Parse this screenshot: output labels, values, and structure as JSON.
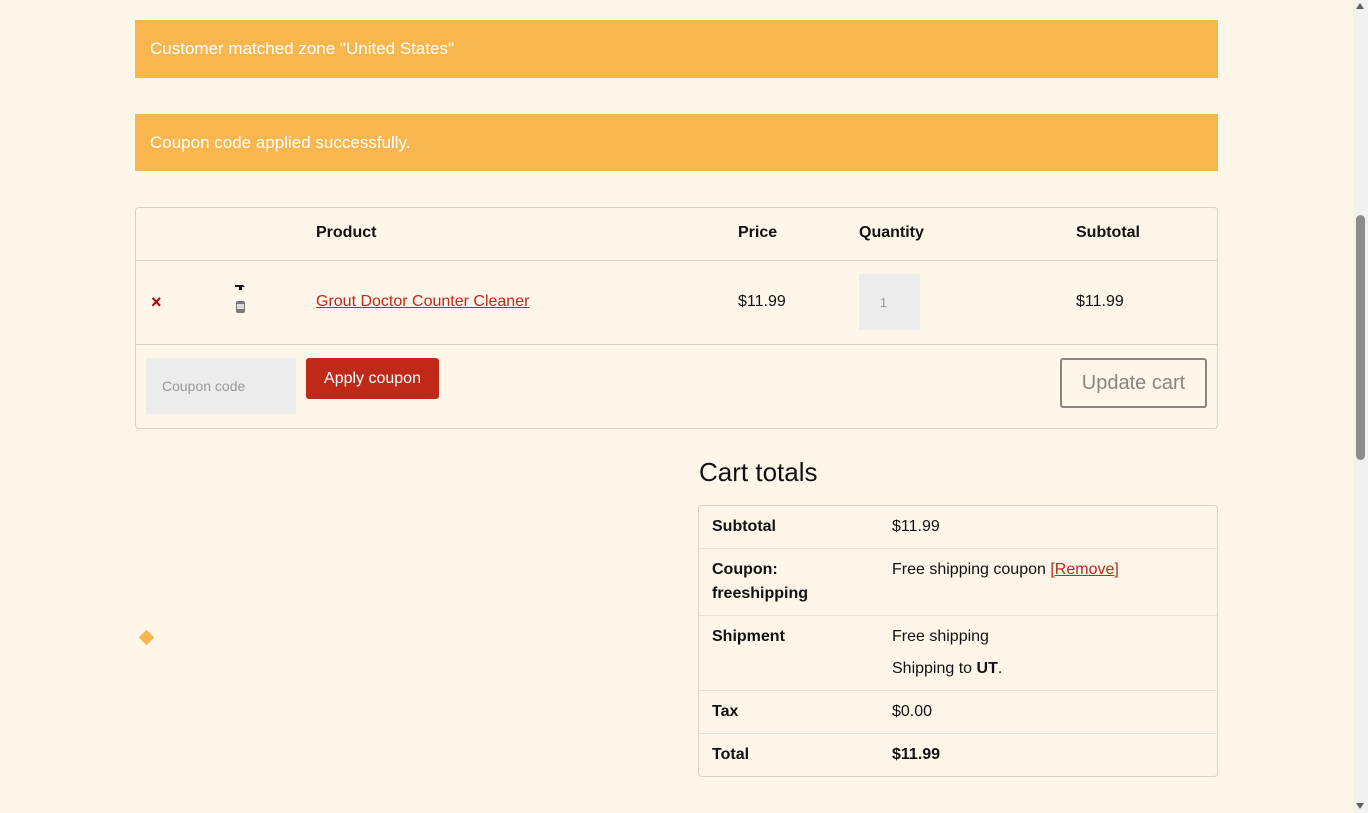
{
  "notices": {
    "zone": "Customer matched zone \"United States\"",
    "coupon": "Coupon code applied successfully."
  },
  "cart": {
    "headers": {
      "product": "Product",
      "price": "Price",
      "quantity": "Quantity",
      "subtotal": "Subtotal"
    },
    "item": {
      "remove_icon": "×",
      "name": "Grout Doctor Counter Cleaner",
      "price": "$11.99",
      "quantity": "1",
      "subtotal": "$11.99"
    },
    "coupon_placeholder": "Coupon code",
    "apply_label": "Apply coupon",
    "update_label": "Update cart"
  },
  "totals": {
    "title": "Cart totals",
    "subtotal_label": "Subtotal",
    "subtotal_value": "$11.99",
    "coupon_label_line1": "Coupon:",
    "coupon_label_line2": "freeshipping",
    "coupon_value": "Free shipping coupon",
    "coupon_remove": "[Remove]",
    "shipment_label": "Shipment",
    "shipment_value": "Free shipping",
    "shipping_to_prefix": "Shipping to",
    "shipping_to_state": "UT",
    "shipping_to_suffix": ".",
    "tax_label": "Tax",
    "tax_value": "$0.00",
    "total_label": "Total",
    "total_value": "$11.99"
  },
  "colors": {
    "notice": "#f8b74e",
    "accent": "#c0281a",
    "background": "#fdf6e9"
  }
}
